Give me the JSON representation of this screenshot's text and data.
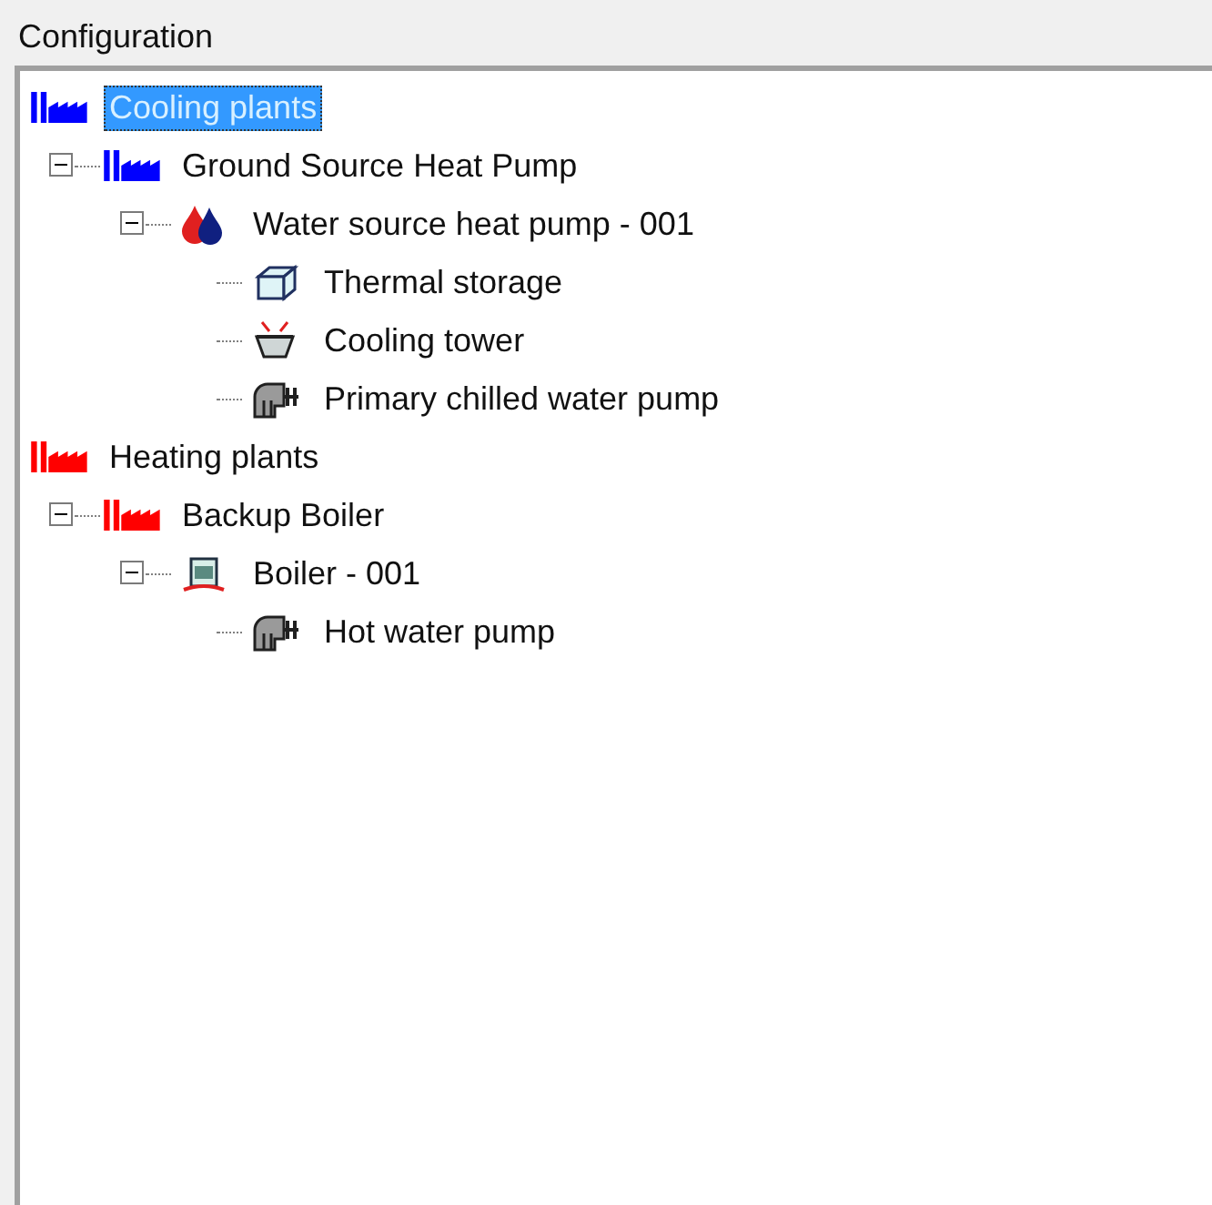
{
  "title": "Configuration",
  "tree": [
    {
      "label": "Cooling plants",
      "kind": "plant",
      "color": "#0000ff",
      "selected": true,
      "children": [
        {
          "label": "Ground Source Heat Pump",
          "kind": "plant",
          "color": "#0000ff",
          "selected": false,
          "expanded": true,
          "children": [
            {
              "label": "Water source heat pump - 001",
              "kind": "heatpump",
              "selected": false,
              "expanded": true,
              "children": [
                {
                  "label": "Thermal storage",
                  "kind": "storage",
                  "selected": false
                },
                {
                  "label": "Cooling tower",
                  "kind": "tower",
                  "selected": false
                },
                {
                  "label": "Primary chilled water pump",
                  "kind": "pump",
                  "selected": false
                }
              ]
            }
          ]
        }
      ]
    },
    {
      "label": "Heating plants",
      "kind": "plant",
      "color": "#ff0000",
      "selected": false,
      "children": [
        {
          "label": "Backup Boiler",
          "kind": "plant",
          "color": "#ff0000",
          "selected": false,
          "expanded": true,
          "children": [
            {
              "label": "Boiler - 001",
              "kind": "boiler",
              "selected": false,
              "expanded": true,
              "children": [
                {
                  "label": "Hot water pump",
                  "kind": "pump",
                  "selected": false
                }
              ]
            }
          ]
        }
      ]
    }
  ]
}
